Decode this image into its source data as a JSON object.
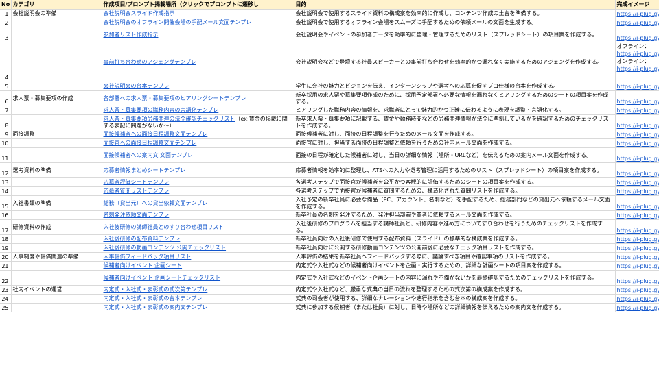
{
  "headers": [
    "No",
    "カテゴリ",
    "作成項目/プロンプト掲載場所（クリックでプロンプトに遷移し",
    "目的",
    "完成イメージ"
  ],
  "rows": [
    {
      "no": "1",
      "category": "会社説明会の準備",
      "template": "会社説明会スライド作成指示",
      "note": "",
      "purpose": "会社説明会で使用するスライド資料の構成案を効率的に作成し、コンテンツ作成の土台を準備する。",
      "image": "https://i-plug.gy"
    },
    {
      "no": "2",
      "category": "",
      "template": "会社説明会のオフライン開催会場の手配メール文面テンプレ",
      "note": "",
      "purpose": "会社説明会で使用するオフライン会場をスムーズに手配するための依頼メールの文面を生成する。",
      "image": "https://i-plug.gy"
    },
    {
      "no": "3",
      "category": "",
      "template": "参加者リスト作成指示",
      "note": "",
      "purpose": "会社説明会やイベントの参加者データを効率的に整理・管理するためのリスト（スプレッドシート）の項目案を作成する。",
      "image": "https://i-plug.gy"
    },
    {
      "no": "4",
      "category": "",
      "template": "事前打ち合わせのアジェンダテンプレ",
      "note": "",
      "purpose": "会社説明会などで登壇する社員スピーカーとの事前打ち合わせを効率的かつ漏れなく実施するためのアジェンダを作成する。",
      "image_lines": [
        "オフライン：",
        "https://i-plug.gy",
        "オンライン：",
        "https://i-plug.gy"
      ]
    },
    {
      "no": "5",
      "category": "",
      "template": "会社説明会の台本テンプレ",
      "note": "",
      "purpose": "学生に会社の魅力とビジョンを伝え、インターンシップや選考への応募を促すプロ仕様の台本を作成する。",
      "image": "https://i-plug.gy"
    },
    {
      "no": "6",
      "category": "求人票・募集要項の作成",
      "template": "各部署への求人票・募集要項のヒアリングシートテンプレ",
      "note": "",
      "purpose": "新卒採用の求人票や募集要項作成のために、採用予定部署へ必要な情報を漏れなくヒアリングするためのシートの項目案を作成する。",
      "image": "https://i-plug.gy"
    },
    {
      "no": "7",
      "category": "",
      "template": "求人票・募集要項の職務内容の言語化テンプレ",
      "note": "",
      "purpose": "ヒアリングした職務内容の情報を、求職者にとって魅力的かつ正確に伝わるように表現を調整・言語化する。",
      "image": "https://i-plug.gy"
    },
    {
      "no": "8",
      "category": "",
      "template": "求人票・募集要項労務関連の法令確認チェックリスト",
      "note": "（ex:賃金の掲載に関する表記に問題がないか〜）",
      "purpose": "新卒求人票・募集要項に記載する、賃金や勤務時間などの労務関連情報が法令に準拠しているかを確認するためのチェックリストを作成する。",
      "image": "https://i-plug.gy"
    },
    {
      "no": "9",
      "category": "面接調整",
      "template": "面接候補者への面接日程調整文面テンプレ",
      "note": "",
      "purpose": "面接候補者に対し、面接の日程調整を行うためのメール文面を作成する。",
      "image": "https://i-plug.gy"
    },
    {
      "no": "10",
      "category": "",
      "template": "面接官への面接日程調整文面テンプレ",
      "note": "",
      "purpose": "面接官に対し、担当する面接の日程調整と依頼を行うための社内メール文面を作成する。",
      "image": "https://i-plug.gy"
    },
    {
      "no": "11",
      "category": "",
      "template": "面接候補者への案内文 文面テンプレ",
      "note": "",
      "purpose": "面接の日程が確定した候補者に対し、当日の詳細な情報（場所・URLなど）を伝えるための案内メール文面を作成する。",
      "image": "https://i-plug.gy"
    },
    {
      "no": "12",
      "category": "選考資料の準備",
      "template": "応募者情報まとめシートテンプレ",
      "note": "",
      "purpose": "応募者情報を効率的に整理し、ATSへの入力や選考管理に活用するためのリスト（スプレッドシート）の項目案を作成する。",
      "image": "https://i-plug.gy"
    },
    {
      "no": "13",
      "category": "",
      "template": "応募者評価シートテンプレ",
      "note": "",
      "purpose": "各選考ステップで面接官が候補者を公平かつ客観的に評価するためのシートの項目案を作成する。",
      "image": "https://i-plug.gy"
    },
    {
      "no": "14",
      "category": "",
      "template": "応募者質問リストテンプレ",
      "note": "",
      "purpose": "各選考ステップで面接官が候補者に質問するための、構造化された質問リストを作成する。",
      "image": "https://i-plug.gy"
    },
    {
      "no": "15",
      "category": "入社書類の準備",
      "template": "総務（貸出元）への貸出依頼文面テンプレ",
      "note": "",
      "purpose": "入社予定の新卒社員に必要な備品（PC、アカウント、名刺など）を手配するため、総務部門などの貸出元へ依頼するメール文面を作成する。",
      "image": "https://i-plug.gy"
    },
    {
      "no": "16",
      "category": "",
      "template": "名刺発注依頼文面テンプレ",
      "note": "",
      "purpose": "新卒社員の名刺を発注するため、発注担当部署や業者に依頼するメール文面を作成する。",
      "image": "https://i-plug.gy"
    },
    {
      "no": "17",
      "category": "研修資料の作成",
      "template": "入社後研修の講師社員とのすり合わせ項目リスト",
      "note": "",
      "purpose": "入社後研修のプログラムを担当する講師社員と、研修内容や進め方についてすり合わせを行うためのチェックリストを作成する。",
      "image": "https://i-plug.gy"
    },
    {
      "no": "18",
      "category": "",
      "template": "入社後研修の配布資料テンプレ",
      "note": "",
      "purpose": "新卒社員向けの入社後研修で使用する配布資料（スライド）の標準的な構成案を作成する。",
      "image": "https://i-plug.gy"
    },
    {
      "no": "19",
      "category": "",
      "template": "入社後研修の動画コンテンツ 公開チェックリスト",
      "note": "",
      "purpose": "新卒社員向けに公開する研修動画コンテンツの公開前後に必要なチェック項目リストを作成する。",
      "image": "https://i-plug.gy"
    },
    {
      "no": "20",
      "category": "人事制度や評価関連の準備",
      "template": "人事評価フィードバック項目リスト",
      "note": "",
      "purpose": "人事評価の結果を新卒社員へフィードバックする際に、議論すべき項目や確認事項のリストを作成する。",
      "image": "https://i-plug.gy"
    },
    {
      "no": "21",
      "category": "",
      "template": "候補者向けイベント 企画シート",
      "note": "",
      "purpose": "内定式や入社式などの候補者向けイベントを企画・実行するための、詳細な計画シートの項目案を作成する。",
      "image": "https://i-plug.gy"
    },
    {
      "no": "22",
      "category": "",
      "template": "候補者向けイベント 企画シートチェックリスト",
      "note": "",
      "purpose": "内定式や入社式などのイベント企画シートの内容に漏れや不備がないかを最終確認するためのチェックリストを作成する。",
      "image": "https://i-plug.gy"
    },
    {
      "no": "23",
      "category": "社内イベントの運営",
      "template": "内定式・入社式・表彰式の式次第テンプレ",
      "note": "",
      "purpose": "内定式や入社式など、厳粛な式典の当日の流れを整理するための式次第の構成案を作成する。",
      "image": "https://i-plug.gy"
    },
    {
      "no": "24",
      "category": "",
      "template": "内定式・入社式・表彰式の台本テンプレ",
      "note": "",
      "purpose": "式典の司会者が使用する、詳細なナレーションや進行指示を含む台本の構成案を作成する。",
      "image": "https://i-plug.gy"
    },
    {
      "no": "25",
      "category": "",
      "template": "内定式・入社式・表彰式の案内文テンプレ",
      "note": "",
      "purpose": "式典に参加する候補者（または社員）に対し、日時や場所などの詳細情報を伝えるための案内文を作成する。",
      "image": "https://i-plug.gy"
    }
  ]
}
